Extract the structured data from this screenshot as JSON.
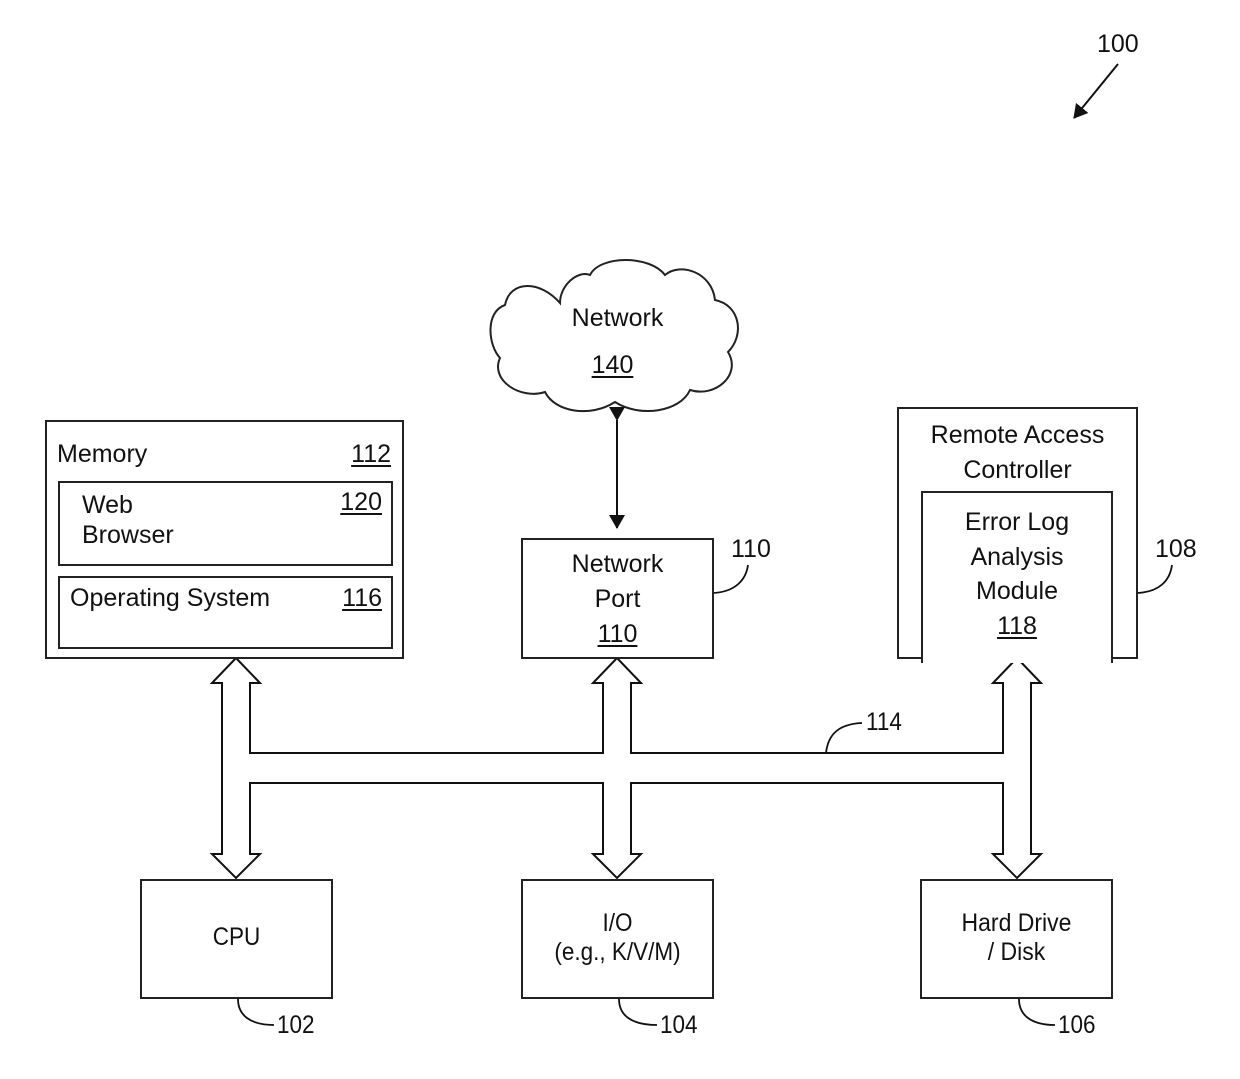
{
  "figure": {
    "reference": "100",
    "type": "system block diagram"
  },
  "network": {
    "name": "Network",
    "ref": "140"
  },
  "memory": {
    "name": "Memory",
    "ref": "112",
    "children": [
      {
        "name_line1": "Web",
        "name_line2": "Browser",
        "ref": "120"
      },
      {
        "name": "Operating System",
        "ref": "116"
      }
    ]
  },
  "network_port": {
    "line1": "Network",
    "line2": "Port",
    "ref": "110",
    "callout": "110"
  },
  "remote_access_controller": {
    "line1": "Remote Access",
    "line2": "Controller",
    "callout": "108",
    "module": {
      "line1": "Error Log",
      "line2": "Analysis",
      "line3": "Module",
      "ref": "118"
    }
  },
  "bus": {
    "callout": "114"
  },
  "cpu": {
    "name": "CPU",
    "callout": "102"
  },
  "io": {
    "line1": "I/O",
    "line2": "(e.g., K/V/M)",
    "callout": "104"
  },
  "hard_drive": {
    "line1": "Hard Drive",
    "line2": "/ Disk",
    "callout": "106"
  }
}
